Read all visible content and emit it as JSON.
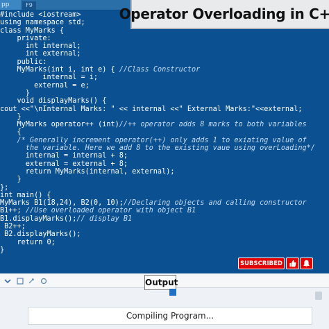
{
  "tabs": {
    "active": "pp",
    "inactive": "F9"
  },
  "title": "Operator Overloading in C++",
  "code_lines": [
    "#include <iostream>",
    "using namespace std;",
    "class MyMarks {",
    "    private:",
    "      int internal;",
    "      int external;",
    "    public:",
    "    MyMarks(int i, int e) { //Class Constructor",
    "          internal = i;",
    "        external = e;",
    "      }",
    "    void displayMarks() {",
    "cout <<\"\\nInternal Marks: \" << internal <<\" External Marks:\"<<external;",
    "    }",
    "    MyMarks operator++ (int)//++ operator adds 8 marks to both variables",
    "    {",
    "    /* Generally increment operator(++) only adds 1 to exiating value of",
    "      the variable. Here we add 8 to the existing vaue using overLoading*/",
    "      internal = internal + 8;",
    "      external = external + 8;",
    "      return MyMarks(internal, external);",
    "    }",
    "};",
    "int main() {",
    "MyMarks B1(18,24), B2(0, 10);//Declaring objects and calling constructor",
    "B1++; //Use overloaded operator with object B1",
    "B1.displayMarks();// display B1",
    " B2++;",
    " B2.displayMarks();",
    "    return 0;",
    "}"
  ],
  "subscribe_label": "SUBSCRIBED",
  "output_label": "Output",
  "status_text": "Compiling Program...",
  "icons": {
    "like": "thumbs-up-icon",
    "bell": "bell-icon",
    "collapse": "chevron-down-icon",
    "toolbar_tools": [
      "tool-icon"
    ]
  },
  "colors": {
    "editor_bg": "#0b5191",
    "subscribe_bg": "#e00000",
    "banner_bg": "#e8eaec"
  }
}
